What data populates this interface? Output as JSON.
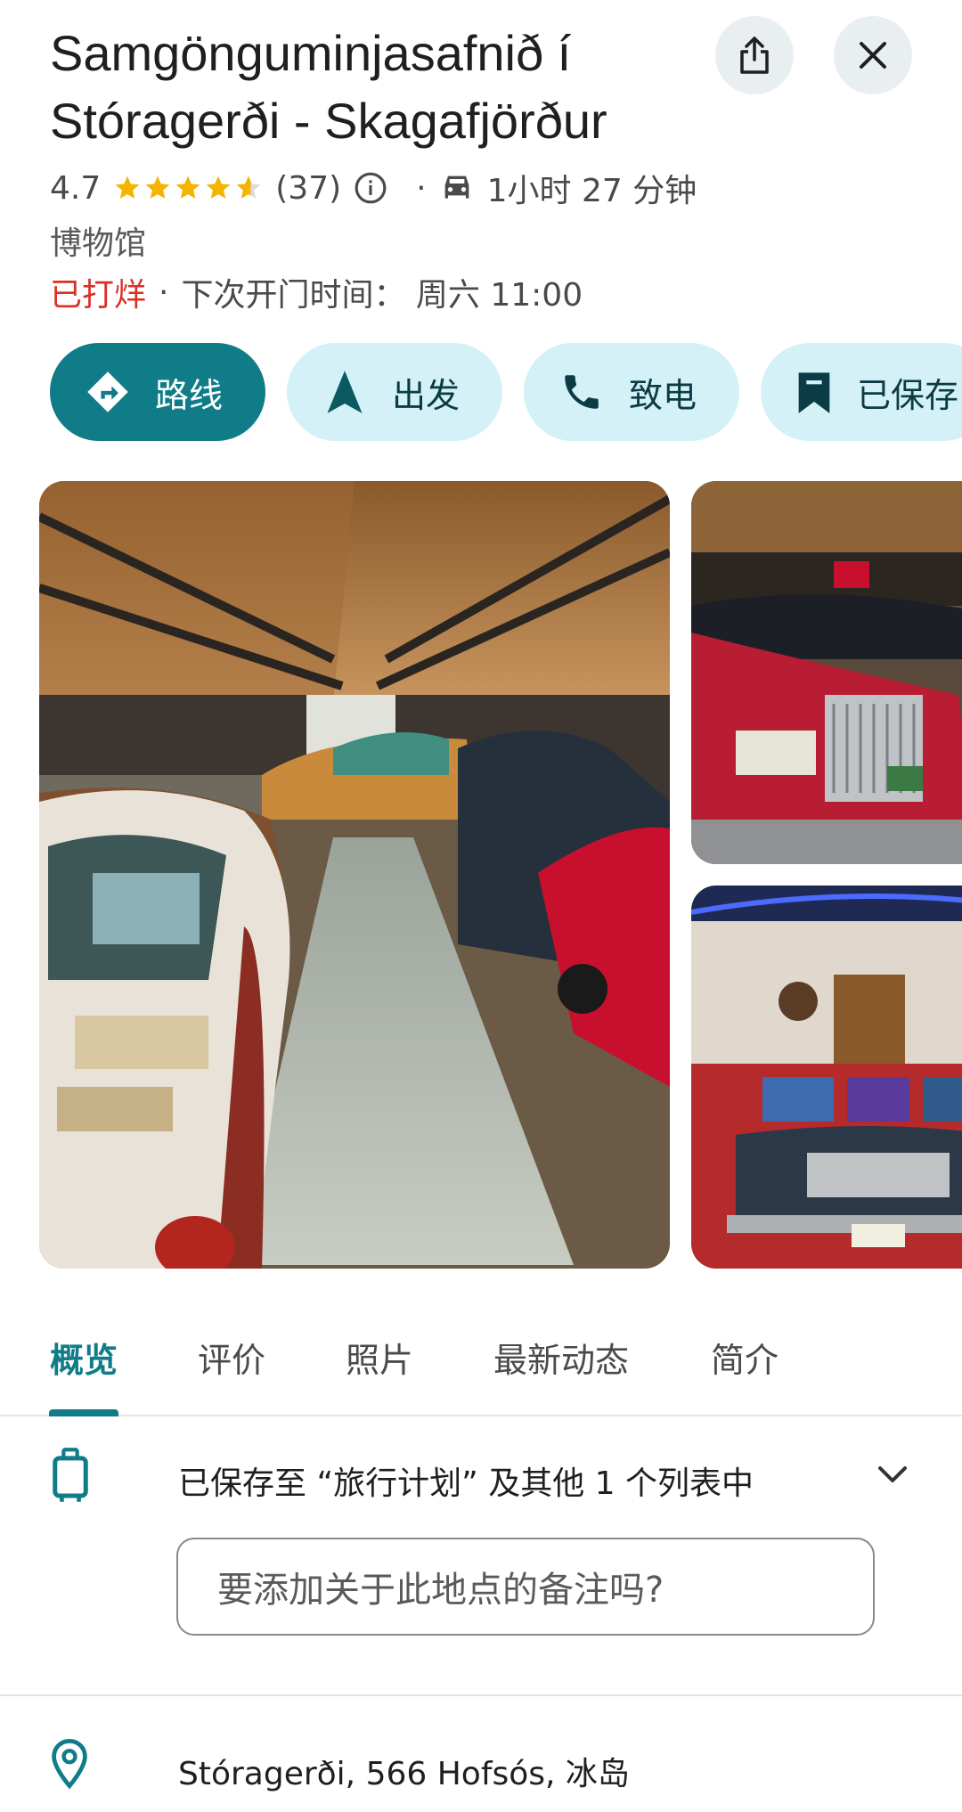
{
  "place": {
    "name": "Samgönguminjasafnið í Stóragerði - Skagafjörður",
    "rating": "4.7",
    "stars": 4.7,
    "review_count": "(37)",
    "drive_time": "1小时 27 分钟",
    "category": "博物馆",
    "status": "已打烊",
    "next_open": "下次开门时间： 周六 11:00"
  },
  "actions": [
    {
      "label": "路线",
      "icon": "directions-icon"
    },
    {
      "label": "出发",
      "icon": "navigation-arrow-icon"
    },
    {
      "label": "致电",
      "icon": "phone-icon"
    },
    {
      "label": "已保存",
      "icon": "bookmark-icon"
    }
  ],
  "tabs": [
    "概览",
    "评价",
    "照片",
    "最新动态",
    "简介"
  ],
  "saved": {
    "text": "已保存至 “旅行计划” 及其他 1 个列表中"
  },
  "note": {
    "placeholder": "要添加关于此地点的备注吗?"
  },
  "address": "Stóragerði, 566 Hofsós, 冰岛",
  "colors": {
    "accent": "#0f7c88",
    "chip_bg": "#d3f1f7",
    "closed_red": "#d93025"
  }
}
